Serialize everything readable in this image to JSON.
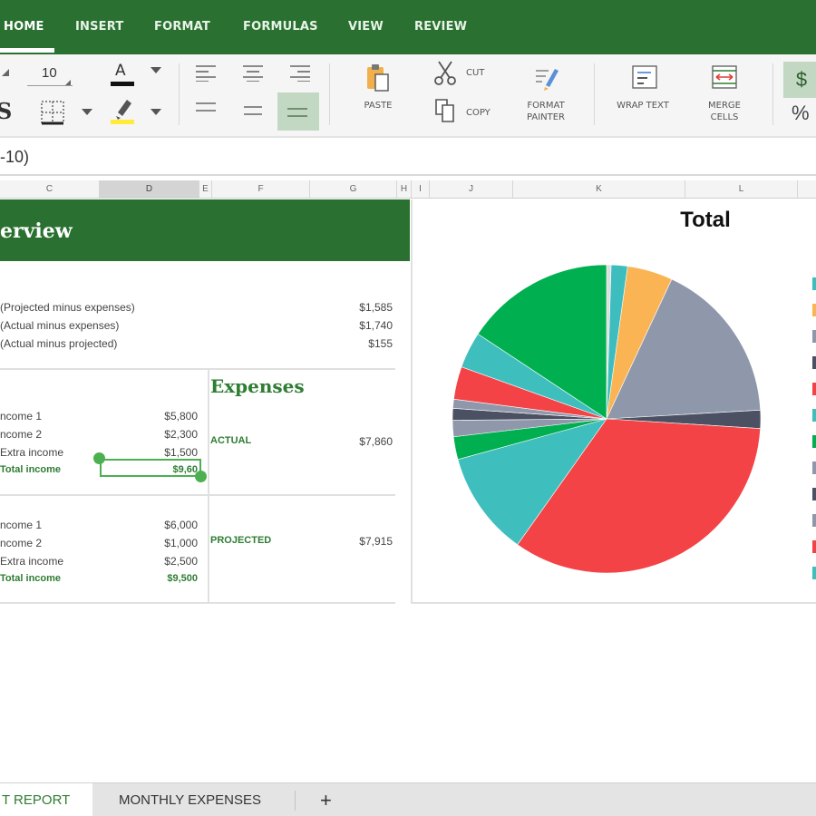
{
  "tabs": [
    {
      "label": "HOME",
      "active": true
    },
    {
      "label": "INSERT"
    },
    {
      "label": "FORMAT"
    },
    {
      "label": "FORMULAS"
    },
    {
      "label": "VIEW"
    },
    {
      "label": "REVIEW"
    }
  ],
  "ribbon": {
    "font_size": "10",
    "bold_glyph": "S",
    "font_color_glyph": "A",
    "paste_label": "PASTE",
    "cut_label": "CUT",
    "copy_label": "COPY",
    "format_painter_label": "FORMAT\nPAINTER",
    "wrap_text_label": "WRAP TEXT",
    "merge_cells_label": "MERGE\nCELLS",
    "currency_glyph": "$",
    "percent_glyph": "%",
    "accent": "#2a7030",
    "font_color": "#111111",
    "highlight_color": "#ffeb3b"
  },
  "formula_bar": {
    "text": "-10)"
  },
  "columns": [
    "C",
    "D",
    "E",
    "F",
    "G",
    "H",
    "I",
    "J",
    "K",
    "L"
  ],
  "sheet": {
    "banner_title": "erview",
    "summary": [
      {
        "label": "(Projected  minus expenses)",
        "value": "$1,585"
      },
      {
        "label": "(Actual  minus expenses)",
        "value": "$1,740"
      },
      {
        "label": "(Actual minus projected)",
        "value": "$155"
      }
    ],
    "income_actual": [
      {
        "label": "ncome 1",
        "value": "$5,800"
      },
      {
        "label": "ncome 2",
        "value": "$2,300"
      },
      {
        "label": "Extra income",
        "value": "$1,500"
      },
      {
        "label": "Total income",
        "value": "$9,60"
      }
    ],
    "income_projected": [
      {
        "label": "ncome 1",
        "value": "$6,000"
      },
      {
        "label": "ncome 2",
        "value": "$1,000"
      },
      {
        "label": "Extra income",
        "value": "$2,500"
      },
      {
        "label": "Total income",
        "value": "$9,500"
      }
    ],
    "expenses_title": "Expenses",
    "expenses": [
      {
        "label": "ACTUAL",
        "value": "$7,860"
      },
      {
        "label": "PROJECTED",
        "value": "$7,915"
      }
    ]
  },
  "chart_data": {
    "type": "pie",
    "title": "Total",
    "categories": [
      "",
      "",
      "",
      "",
      "",
      "",
      "",
      "",
      "",
      "",
      "",
      "",
      "",
      ""
    ],
    "values": [
      0.5,
      1.8,
      5.0,
      18.0,
      2.0,
      35.5,
      11.5,
      2.5,
      1.8,
      1.3,
      1.0,
      3.6,
      4.0,
      16.5
    ],
    "colors": [
      "#dddddd",
      "#3dbdbd",
      "#fbb454",
      "#8f98aa",
      "#4b5163",
      "#f44346",
      "#3fbebe",
      "#00b050",
      "#8f98aa",
      "#4b5163",
      "#8f98aa",
      "#f44346",
      "#3fbebe",
      "#00b050"
    ],
    "legend": "right"
  },
  "sheet_tabs": {
    "active": "T REPORT",
    "other": "MONTHLY EXPENSES",
    "add": "+"
  }
}
